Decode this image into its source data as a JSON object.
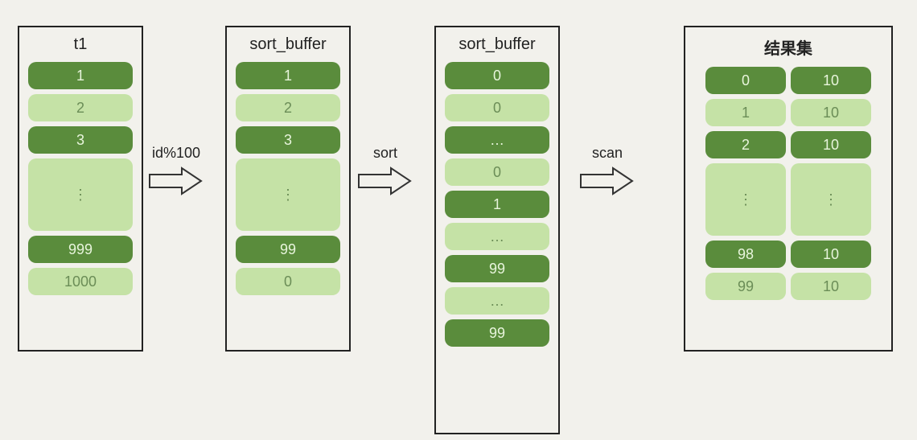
{
  "panels": {
    "t1": {
      "title": "t1",
      "items": [
        {
          "v": "1",
          "shade": "dark"
        },
        {
          "v": "2",
          "shade": "light"
        },
        {
          "v": "3",
          "shade": "dark"
        },
        {
          "v": "⋮",
          "shade": "light"
        },
        {
          "v": "999",
          "shade": "dark"
        },
        {
          "v": "1000",
          "shade": "light"
        }
      ]
    },
    "sb1": {
      "title": "sort_buffer",
      "items": [
        {
          "v": "1",
          "shade": "dark"
        },
        {
          "v": "2",
          "shade": "light"
        },
        {
          "v": "3",
          "shade": "dark"
        },
        {
          "v": "⋮",
          "shade": "light"
        },
        {
          "v": "99",
          "shade": "dark"
        },
        {
          "v": "0",
          "shade": "light"
        }
      ]
    },
    "sb2": {
      "title": "sort_buffer",
      "items": [
        {
          "v": "0",
          "shade": "dark"
        },
        {
          "v": "0",
          "shade": "light"
        },
        {
          "v": "…",
          "shade": "dark"
        },
        {
          "v": "0",
          "shade": "light"
        },
        {
          "v": "1",
          "shade": "dark"
        },
        {
          "v": "…",
          "shade": "light"
        },
        {
          "v": "99",
          "shade": "dark"
        },
        {
          "v": "…",
          "shade": "light"
        },
        {
          "v": "99",
          "shade": "dark"
        }
      ]
    },
    "res": {
      "title": "结果集",
      "rows": [
        {
          "a": "0",
          "b": "10",
          "shade": "dark"
        },
        {
          "a": "1",
          "b": "10",
          "shade": "light"
        },
        {
          "a": "2",
          "b": "10",
          "shade": "dark"
        },
        {
          "a": "⋮",
          "b": "⋮",
          "shade": "light"
        },
        {
          "a": "98",
          "b": "10",
          "shade": "dark"
        },
        {
          "a": "99",
          "b": "10",
          "shade": "light"
        }
      ]
    }
  },
  "arrows": {
    "a1": "id%100",
    "a2": "sort",
    "a3": "scan"
  },
  "colors": {
    "dark": "#5a8c3c",
    "light": "#c5e2a6",
    "bg": "#f2f1ec"
  }
}
